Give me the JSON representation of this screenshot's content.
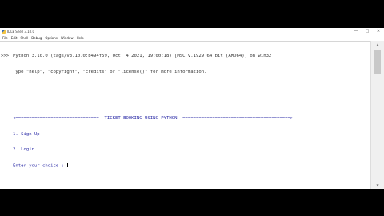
{
  "window": {
    "title": "IDLE Shell 3.10.0",
    "controls": {
      "minimize": "—",
      "maximize": "□",
      "close": "✕"
    }
  },
  "menu": [
    "File",
    "Edit",
    "Shell",
    "Debug",
    "Options",
    "Window",
    "Help"
  ],
  "shell": {
    "banner_1": "Python 3.10.0 (tags/v3.10.0:b494f59, Oct  4 2021, 19:00:18) [MSC v.1929 64 bit (AMD64)] on win32",
    "banner_2": "Type \"help\", \"copyright\", \"credits\" or \"license()\" for more information.",
    "prompt": ">>>",
    "header": "<===============================  TICKET BOOKING USING PYTHON  ========================================>",
    "option_1": "1. Sign Up",
    "option_2": "2. Login",
    "input_prompt": "Enter your choice : "
  },
  "colors": {
    "background": "#000000",
    "window": "#ffffff",
    "output_text": "#2a2aa6",
    "banner_text": "#333333"
  },
  "icons": {
    "app": "python-idle-icon",
    "scroll_up": "chevron-up-icon",
    "scroll_down": "chevron-down-icon"
  }
}
